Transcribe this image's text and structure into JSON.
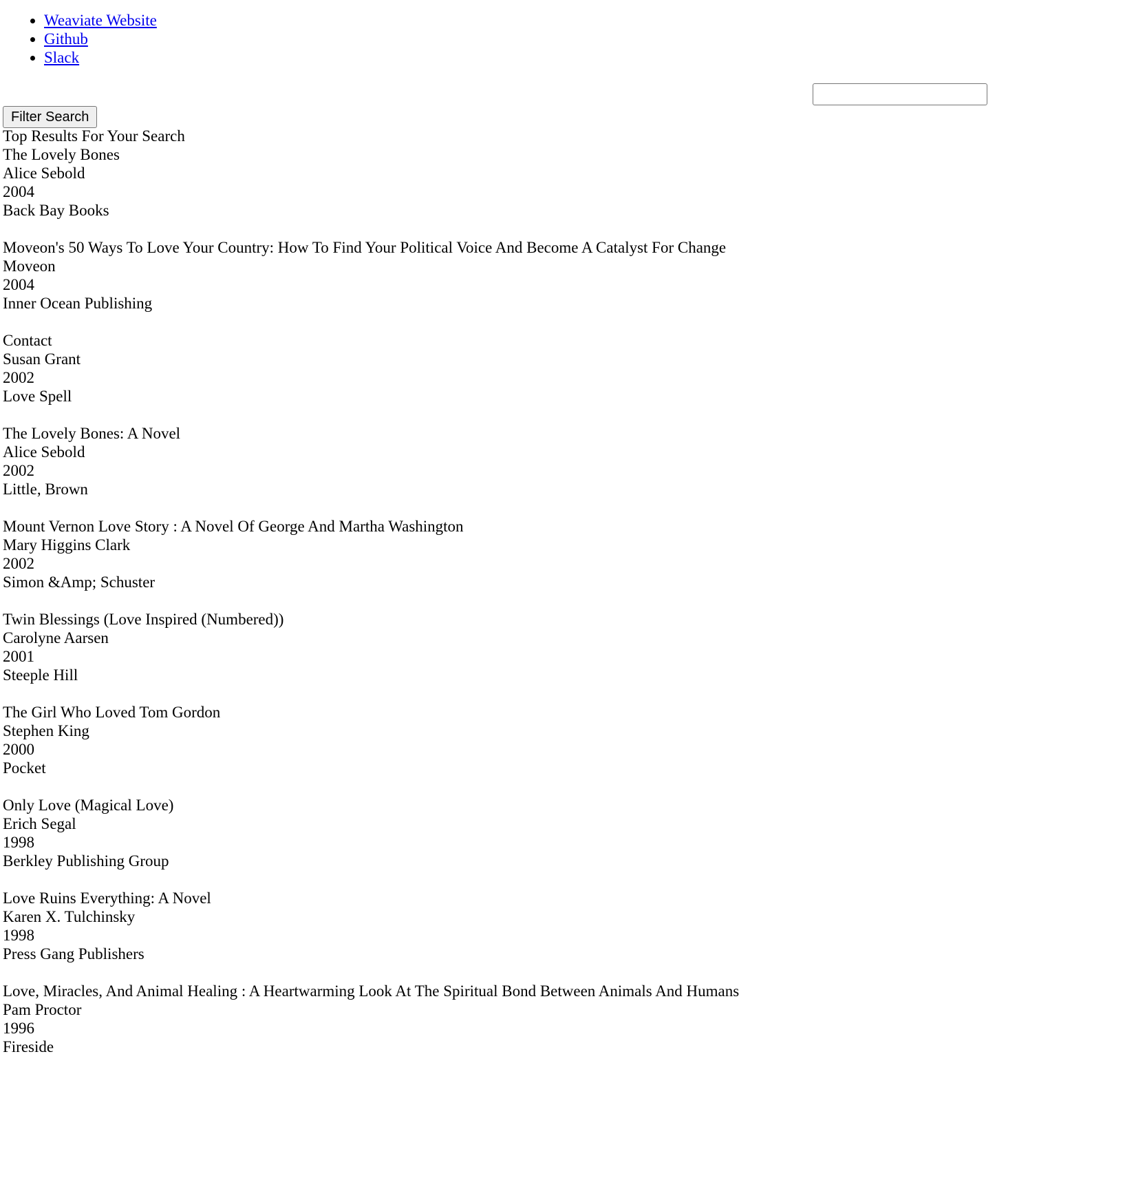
{
  "nav": {
    "links": [
      {
        "label": "Weaviate Website"
      },
      {
        "label": "Github"
      },
      {
        "label": "Slack"
      }
    ]
  },
  "search": {
    "value": "",
    "placeholder": "",
    "filter_button_label": "Filter Search"
  },
  "results": {
    "heading": "Top Results For Your Search",
    "items": [
      {
        "title": "The Lovely Bones",
        "author": "Alice Sebold",
        "year": "2004",
        "publisher": "Back Bay Books"
      },
      {
        "title": "Moveon's 50 Ways To Love Your Country: How To Find Your Political Voice And Become A Catalyst For Change",
        "author": "Moveon",
        "year": "2004",
        "publisher": "Inner Ocean Publishing"
      },
      {
        "title": "Contact",
        "author": "Susan Grant",
        "year": "2002",
        "publisher": "Love Spell"
      },
      {
        "title": "The Lovely Bones: A Novel",
        "author": "Alice Sebold",
        "year": "2002",
        "publisher": "Little, Brown"
      },
      {
        "title": "Mount Vernon Love Story : A Novel Of George And Martha Washington",
        "author": "Mary Higgins Clark",
        "year": "2002",
        "publisher": "Simon &Amp; Schuster"
      },
      {
        "title": "Twin Blessings (Love Inspired (Numbered))",
        "author": "Carolyne Aarsen",
        "year": "2001",
        "publisher": "Steeple Hill"
      },
      {
        "title": "The Girl Who Loved Tom Gordon",
        "author": "Stephen King",
        "year": "2000",
        "publisher": "Pocket"
      },
      {
        "title": "Only Love (Magical Love)",
        "author": "Erich Segal",
        "year": "1998",
        "publisher": "Berkley Publishing Group"
      },
      {
        "title": "Love Ruins Everything: A Novel",
        "author": "Karen X. Tulchinsky",
        "year": "1998",
        "publisher": "Press Gang Publishers"
      },
      {
        "title": "Love, Miracles, And Animal Healing : A Heartwarming Look At The Spiritual Bond Between Animals And Humans",
        "author": "Pam Proctor",
        "year": "1996",
        "publisher": "Fireside"
      }
    ]
  }
}
